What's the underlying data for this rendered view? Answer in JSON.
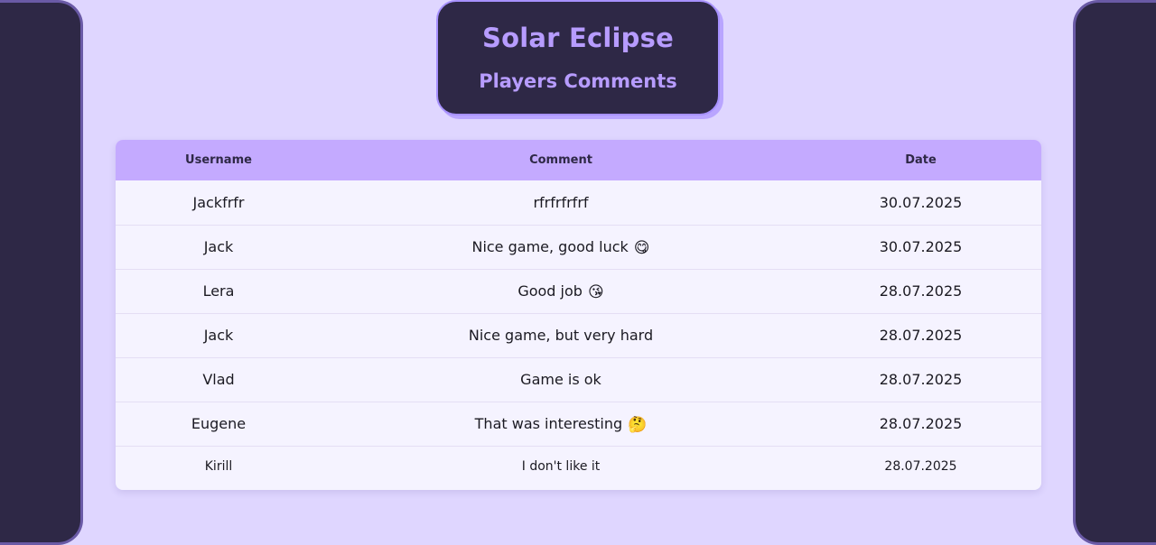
{
  "header": {
    "title": "Solar Eclipse",
    "subtitle": "Players Comments"
  },
  "table": {
    "columns": [
      "Username",
      "Comment",
      "Date"
    ],
    "rows": [
      {
        "username": "Jackfrfr",
        "comment": "rfrfrfrfrf",
        "emoji": "",
        "date": "30.07.2025"
      },
      {
        "username": "Jack",
        "comment": "Nice game, good luck",
        "emoji": "😋",
        "date": "30.07.2025"
      },
      {
        "username": "Lera",
        "comment": "Good job",
        "emoji": "😘",
        "date": "28.07.2025"
      },
      {
        "username": "Jack",
        "comment": "Nice game, but very hard",
        "emoji": "",
        "date": "28.07.2025"
      },
      {
        "username": "Vlad",
        "comment": "Game is ok",
        "emoji": "",
        "date": "28.07.2025"
      },
      {
        "username": "Eugene",
        "comment": "That was interesting",
        "emoji": "🤔",
        "date": "28.07.2025"
      },
      {
        "username": "Kirill",
        "comment": "I don't like it",
        "emoji": "",
        "date": "28.07.2025"
      }
    ]
  },
  "colors": {
    "background": "#dfd6ff",
    "panel": "#2e2846",
    "accent": "#b79cff",
    "table_header": "#c4aaff"
  }
}
